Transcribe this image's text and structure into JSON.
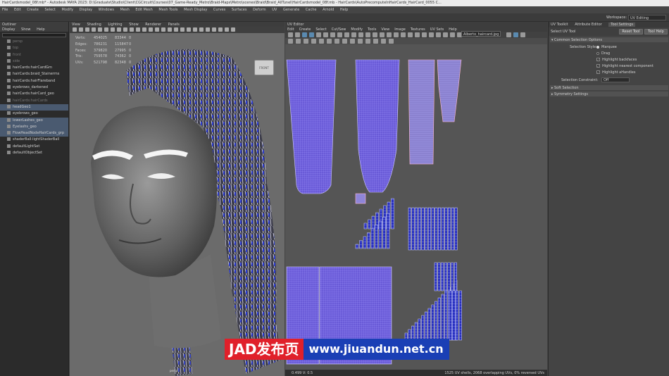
{
  "window": {
    "title": "HairCardsmodel_08f.mb* - Autodesk MAYA 2023: D:\\Graduate\\Studio\\Client\\CGCircuit\\Courses\\07_Game-Ready_Metro\\Braid-Maps\\Metro\\scenes\\Braid\\Braid_AllTunel\\HairCardsmodel_08f.mb - HairCards\\AutoPrecomputeInHairCards_HairCard_0055 C..."
  },
  "menubar": [
    "File",
    "Edit",
    "Create",
    "Select",
    "Modify",
    "Display",
    "Windows",
    "Mesh",
    "Edit Mesh",
    "Mesh Tools",
    "Mesh Display",
    "Curves",
    "Surfaces",
    "Deform",
    "UV",
    "Generate",
    "Cache",
    "Arnold",
    "Help"
  ],
  "workspace": {
    "label": "Workspace:",
    "value": "UV Editing"
  },
  "outliner": {
    "title": "Outliner",
    "menu": [
      "Display",
      "Show",
      "Help"
    ],
    "items": [
      {
        "label": "persp",
        "state": "dim"
      },
      {
        "label": "top",
        "state": "dim"
      },
      {
        "label": "front",
        "state": "dim"
      },
      {
        "label": "side",
        "state": "dim"
      },
      {
        "label": "hairCards:hairCardGrn",
        "state": "normal"
      },
      {
        "label": "hairCards:braid_Stainerms",
        "state": "normal"
      },
      {
        "label": "hairCards:hairFlareband",
        "state": "normal"
      },
      {
        "label": "eyebrows_darkened",
        "state": "normal"
      },
      {
        "label": "hairCards:hairCard_geo",
        "state": "normal"
      },
      {
        "label": "hairCards:hairCards",
        "state": "dim"
      },
      {
        "label": "headGeo1",
        "state": "sel"
      },
      {
        "label": "eyebrows_geo",
        "state": "normal"
      },
      {
        "label": "lowerLashes_geo",
        "state": "sel"
      },
      {
        "label": "Eyelashs_geo",
        "state": "sel"
      },
      {
        "label": "FlowHeadNodeHairCards_grp",
        "state": "sel"
      },
      {
        "label": "shaderBall:lightShaderBall",
        "state": "normal"
      },
      {
        "label": "defaultLightSet",
        "state": "normal"
      },
      {
        "label": "defaultObjectSet",
        "state": "normal"
      }
    ]
  },
  "viewport": {
    "menu": [
      "View",
      "Shading",
      "Lighting",
      "Show",
      "Renderer",
      "Panels"
    ],
    "hud": [
      {
        "label": "Verts:",
        "value": "454025",
        "extra": "83344",
        "extra2": "0"
      },
      {
        "label": "Edges:",
        "value": "786231",
        "extra": "115847",
        "extra2": "0"
      },
      {
        "label": "Faces:",
        "value": "379820",
        "extra": "27995",
        "extra2": "0"
      },
      {
        "label": "Tris:",
        "value": "759578",
        "extra": "74362",
        "extra2": "0"
      },
      {
        "label": "UVs:",
        "value": "521798",
        "extra": "82348",
        "extra2": "0"
      }
    ],
    "camera": "persp",
    "viewcube_label": "FRONT"
  },
  "uv_editor": {
    "title": "UV Editor",
    "menu": [
      "Edit",
      "Create",
      "Select",
      "Cut/Sew",
      "Modify",
      "Tools",
      "View",
      "Image",
      "Textures",
      "UV Sets",
      "Help"
    ],
    "texture_select": "Alberto_haircard.jpg",
    "status_left": "0.499 V: 0.5",
    "status_right": "1525 UV shells, 2068 overlapping UVs, 0% reversed UVs"
  },
  "tool_settings": {
    "tabs": [
      "UV Toolkit",
      "Attribute Editor",
      "Tool Settings"
    ],
    "active_tab": "Tool Settings",
    "tool_name": "Select UV Tool",
    "reset_button": "Reset Tool",
    "help_button": "Tool Help",
    "sections": {
      "common": "Common Selection Options",
      "soft": "Soft Selection",
      "symmetry": "Symmetry Settings"
    },
    "selection_style_label": "Selection Style:",
    "marquee": "Marquee",
    "drag": "Drag",
    "check_items": [
      "Highlight backfaces",
      "Highlight nearest component",
      "Highlight aHandles"
    ],
    "selection_constraint_label": "Selection Constraint:",
    "selection_constraint_value": "Off"
  },
  "watermark": {
    "red_text": "JAD发布页",
    "blue_text": "www.jiuandun.net.cn"
  }
}
